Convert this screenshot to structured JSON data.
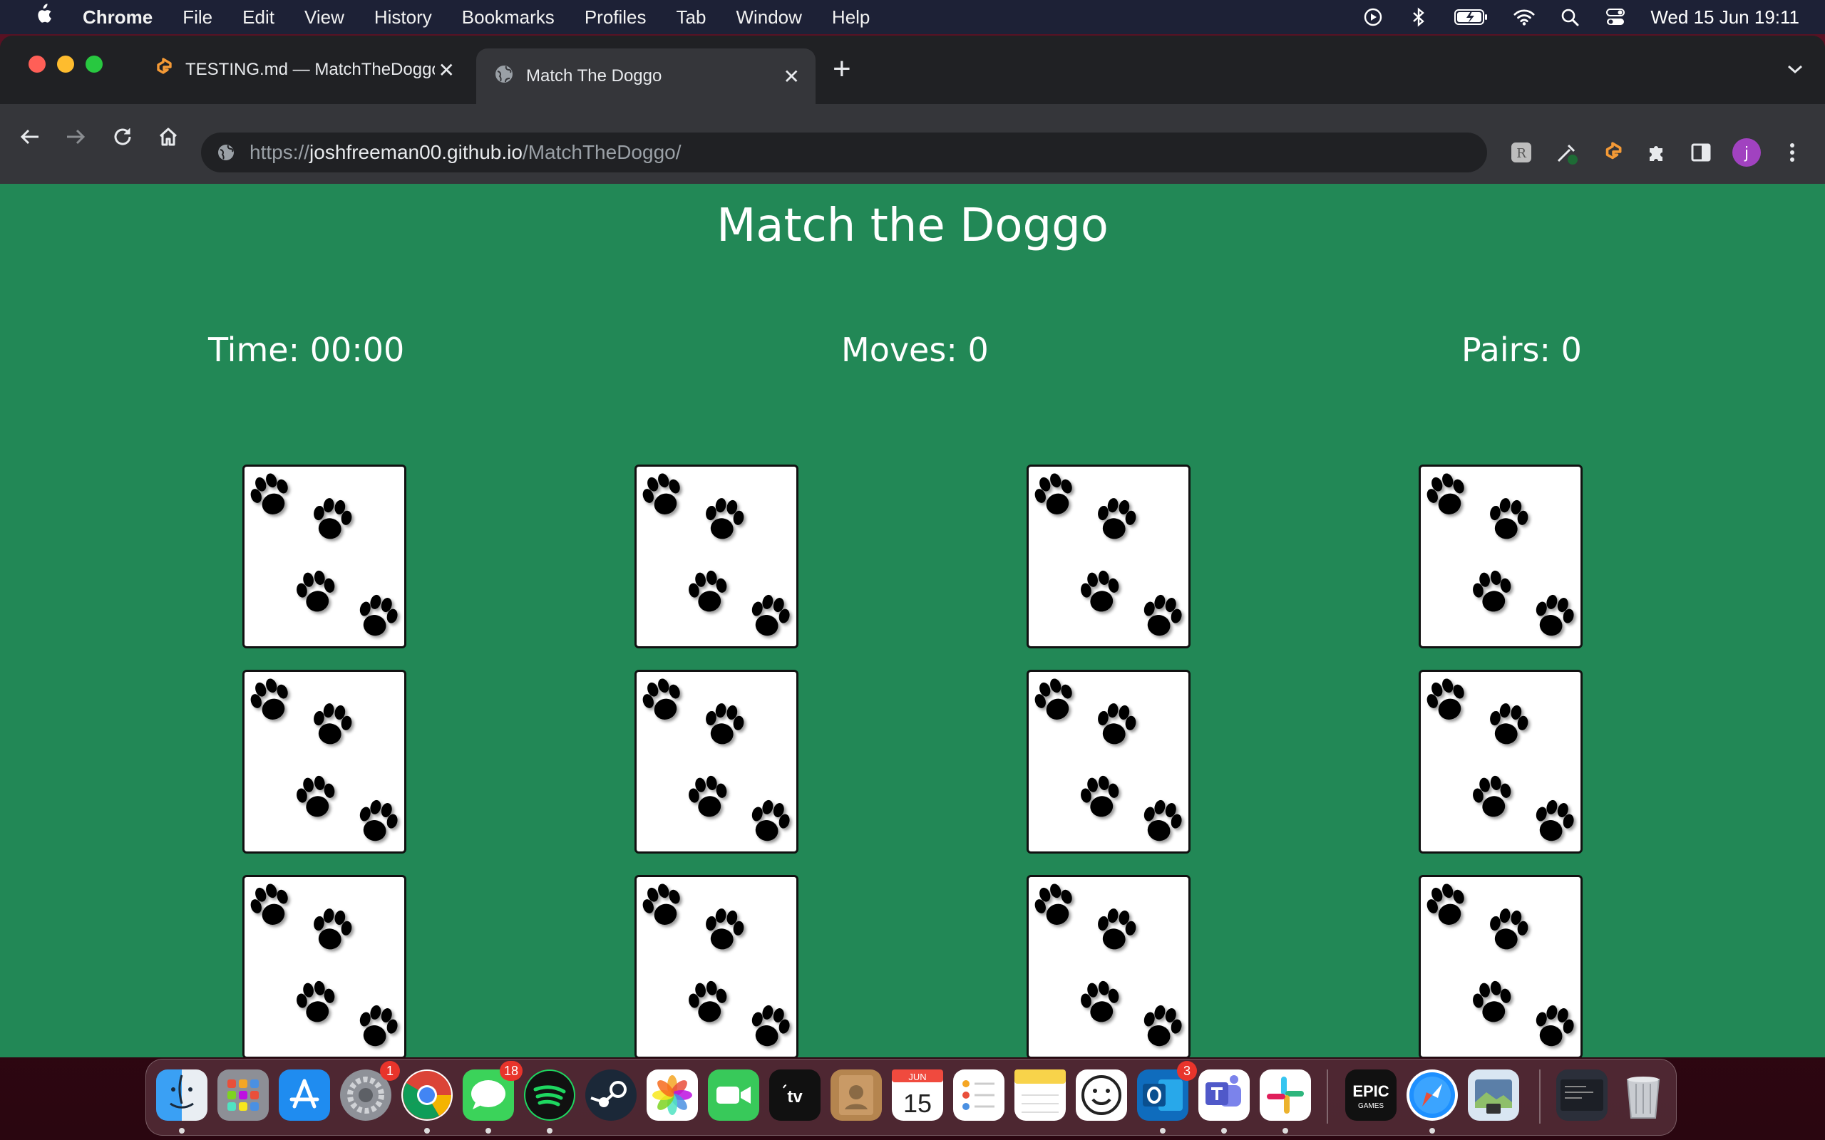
{
  "menubar": {
    "app_name": "Chrome",
    "items": [
      "File",
      "Edit",
      "View",
      "History",
      "Bookmarks",
      "Profiles",
      "Tab",
      "Window",
      "Help"
    ],
    "clock": "Wed 15 Jun  19:11"
  },
  "browser": {
    "tabs": [
      {
        "title": "TESTING.md — MatchTheDoggo",
        "active": false
      },
      {
        "title": "Match The Doggo",
        "active": true
      }
    ],
    "url_scheme": "https://",
    "url_host": "joshfreeman00.github.io",
    "url_path": "/MatchTheDoggo/"
  },
  "game": {
    "title": "Match the Doggo",
    "time_label": "Time: 00:00",
    "moves_label": "Moves: 0",
    "pairs_label": "Pairs: 0",
    "card_back": "paw-prints",
    "card_count": 12
  },
  "dock": {
    "badges": {
      "system_preferences": "1",
      "messages": "18",
      "outlook": "3"
    },
    "calendar_month": "JUN",
    "calendar_day": "15",
    "epic_label_top": "EPIC",
    "epic_label_bottom": "GAMES"
  },
  "colors": {
    "page_bg": "#228856",
    "menubar_bg": "#1d2136",
    "browser_bg": "#202124",
    "toolbar_bg": "#35363a"
  }
}
